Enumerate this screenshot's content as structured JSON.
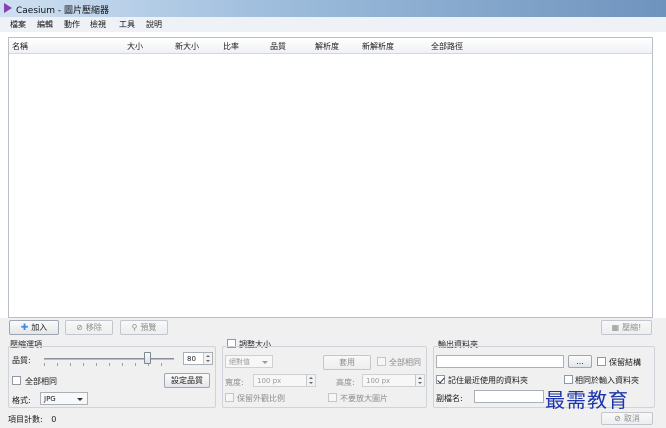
{
  "window": {
    "title": "Caesium - 圖片壓縮器"
  },
  "menu": [
    "檔案",
    "編輯",
    "動作",
    "檢視",
    "工具",
    "說明"
  ],
  "table": {
    "columns": [
      "名稱",
      "大小",
      "新大小",
      "比率",
      "品質",
      "解析度",
      "新解析度",
      "全部路徑"
    ],
    "rows": []
  },
  "toolbar": {
    "add_label": "加入",
    "remove_label": "移除",
    "preview_label": "預覽",
    "compress_label": "壓縮!"
  },
  "compression": {
    "group_title": "壓縮選項",
    "quality_label": "品質:",
    "quality_value": "80",
    "quality_level": 80,
    "all_same_label": "全部相同",
    "set_quality_label": "設定品質",
    "format_label": "格式:",
    "format_value": "JPG"
  },
  "resize": {
    "group_title": "調整大小",
    "mode_value": "絕對值",
    "apply_label": "套用",
    "all_same_label": "全部相同",
    "width_label": "寬度:",
    "width_value": "100 px",
    "height_label": "高度:",
    "height_value": "100 px",
    "keep_ratio_label": "保留外觀比例",
    "no_enlarge_label": "不要放大圖片"
  },
  "output": {
    "group_title": "輸出資料夾",
    "path_value": "",
    "browse_label": "...",
    "keep_structure_label": "保留結構",
    "remember_label": "記住最近使用的資料夾",
    "same_as_input_label": "相同於輸入資料夾",
    "suffix_label": "副檔名:",
    "suffix_value": ""
  },
  "status": {
    "count_label": "項目計數:",
    "count_value": "0",
    "cancel_label": "取消"
  },
  "watermark": {
    "text": "最需教育"
  },
  "colors": {
    "titlebar": "#9fbedd",
    "watermark": "#1d35a8",
    "add_icon": "#3d8bd6"
  }
}
